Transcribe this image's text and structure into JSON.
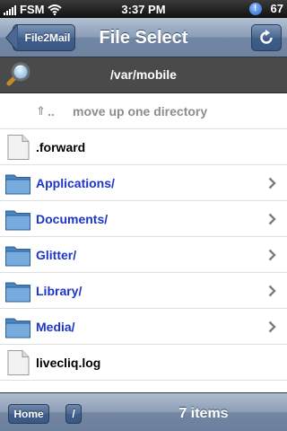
{
  "status_bar": {
    "carrier": "FSM",
    "time": "3:37 PM",
    "battery": "67"
  },
  "nav": {
    "back_label": "File2Mail",
    "title": "File Select"
  },
  "path_bar": {
    "path": "/var/mobile"
  },
  "list": {
    "up_row": {
      "dots": "..",
      "text": "move up one directory"
    },
    "items": [
      {
        "label": ".forward",
        "type": "file"
      },
      {
        "label": "Applications/",
        "type": "folder"
      },
      {
        "label": "Documents/",
        "type": "folder"
      },
      {
        "label": "Glitter/",
        "type": "folder"
      },
      {
        "label": "Library/",
        "type": "folder"
      },
      {
        "label": "Media/",
        "type": "folder"
      },
      {
        "label": "livecliq.log",
        "type": "file"
      }
    ]
  },
  "toolbar": {
    "home_label": "Home",
    "root_label": "/",
    "count": "7 items"
  },
  "icons": {
    "folder": "folder-icon",
    "file": "file-icon",
    "chevron": "chevron-right-icon",
    "refresh": "refresh-icon",
    "search": "magnifier-icon",
    "up": "up-arrow-icon",
    "wifi": "wifi-icon",
    "signal": "signal-icon",
    "notification": "notification-icon"
  },
  "colors": {
    "folder_label": "#1d34c9",
    "nav_bar": "#8a9db6",
    "path_bar": "#4a4a4a"
  }
}
